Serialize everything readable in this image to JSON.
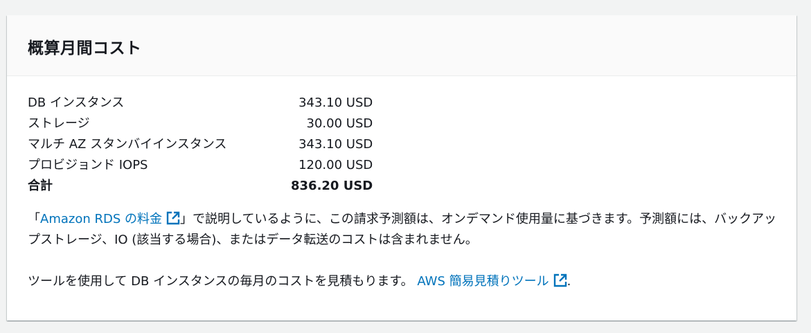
{
  "panel": {
    "title": "概算月間コスト"
  },
  "costs": [
    {
      "label": "DB インスタンス",
      "value": "343.10 USD"
    },
    {
      "label": "ストレージ",
      "value": "30.00 USD"
    },
    {
      "label": "マルチ AZ スタンバイインスタンス",
      "value": "343.10 USD"
    },
    {
      "label": "プロビジョンド IOPS",
      "value": "120.00 USD"
    }
  ],
  "total": {
    "label": "合計",
    "value": "836.20 USD"
  },
  "note": {
    "open_bracket": "「",
    "link_text": "Amazon RDS の料金",
    "rest": "」で説明しているように、この請求予測額は、オンデマンド使用量に基づきます。予測額には、バックアップストレージ、IO (該当する場合)、またはデータ転送のコストは含まれません。"
  },
  "tool_note": {
    "text": "ツールを使用して DB インスタンスの毎月のコストを見積もります。",
    "link_text": "AWS 簡易見積りツール",
    "suffix": "."
  },
  "colors": {
    "link": "#0073bb",
    "header_bg": "#fafafa",
    "page_bg": "#f2f3f3"
  },
  "icons": {
    "external_link": "external-link-icon"
  }
}
